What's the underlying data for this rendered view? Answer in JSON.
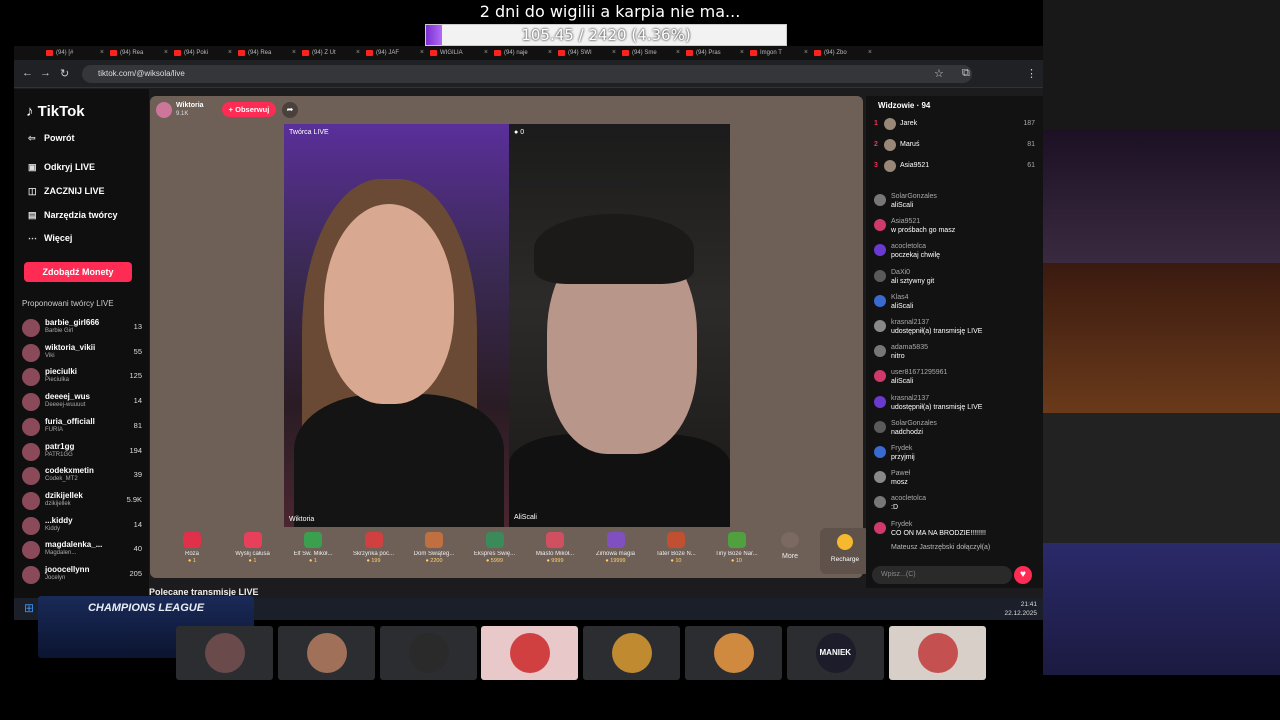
{
  "overlay": {
    "title": "2 dni do wigilii a karpia nie ma...",
    "goal_text": "105.45 / 2420 (4.36%)",
    "goal_progress": 0.0436,
    "accent": "#8a3ee0"
  },
  "browser": {
    "url": "tiktok.com/@wiksola/live",
    "tabs": [
      "(94) [#",
      "(94) Rea",
      "(94) Poki",
      "(94) Rea",
      "(94) Z Ut",
      "(94) JAF",
      "WIGILIA",
      "(94) naje",
      "(94) SWI",
      "(94) Sme",
      "(94) Pras",
      "Imgon T",
      "(94) Zbo"
    ]
  },
  "sidebar": {
    "logo": "TikTok",
    "items": [
      {
        "icon": "back-icon",
        "label": "Powrót"
      },
      {
        "icon": "live-icon",
        "label": "Odkryj LIVE"
      },
      {
        "icon": "camera-icon",
        "label": "ZACZNIJ LIVE"
      },
      {
        "icon": "tools-icon",
        "label": "Narzędzia twórcy"
      },
      {
        "icon": "more-icon",
        "label": "Więcej"
      }
    ],
    "coins_button": "Zdobądź Monety",
    "suggested_title": "Proponowani twórcy LIVE",
    "creators": [
      {
        "name": "barbie_girl666",
        "sub": "Barbie Girl",
        "count": "13"
      },
      {
        "name": "wiktoria_vikii",
        "sub": "Viki",
        "count": "55"
      },
      {
        "name": "pieciulki",
        "sub": "Pieciulka",
        "count": "125"
      },
      {
        "name": "deeeej_wus",
        "sub": "Deeeej-wuuuut",
        "count": "14"
      },
      {
        "name": "furia_officiall",
        "sub": "FURIA",
        "count": "81"
      },
      {
        "name": "patr1gg",
        "sub": "PATR1GG",
        "count": "194"
      },
      {
        "name": "codekxmetin",
        "sub": "Codek_MT2",
        "count": "39"
      },
      {
        "name": "dzikijellek",
        "sub": "dzikijellek",
        "count": "5.9K"
      },
      {
        "name": "...kiddy",
        "sub": "Kiddy",
        "count": "14"
      },
      {
        "name": "magdalenka_...",
        "sub": "Magdalen...",
        "count": "40"
      },
      {
        "name": "jooocellynn",
        "sub": "Jocelyn",
        "count": "205"
      }
    ]
  },
  "live": {
    "host_name": "Wiktoria",
    "host_likes": "9.1K",
    "follow_label": "+ Obserwuj",
    "left_label": "Twórca LIVE",
    "left_name": "Wiktoria",
    "right_name": "AliScali",
    "right_count": "0",
    "gifts": [
      {
        "name": "Róża",
        "price": "1",
        "color": "#e0304a"
      },
      {
        "name": "Wyślij całusa",
        "price": "1",
        "color": "#e8405a"
      },
      {
        "name": "Elf Św. Mikoł...",
        "price": "1",
        "color": "#3aa050"
      },
      {
        "name": "Skrzynka poc...",
        "price": "199",
        "color": "#d04040"
      },
      {
        "name": "Dom Świąteg...",
        "price": "2200",
        "color": "#c07040"
      },
      {
        "name": "Ekspres Świę...",
        "price": "5999",
        "color": "#3a8a5a"
      },
      {
        "name": "Miasto Mikoł...",
        "price": "9999",
        "color": "#d05060"
      },
      {
        "name": "Zimowa magia",
        "price": "19999",
        "color": "#8050c0"
      },
      {
        "name": "Tater Boże N...",
        "price": "10",
        "color": "#c05030"
      },
      {
        "name": "Tiny Boże Nar...",
        "price": "10",
        "color": "#50a040"
      }
    ],
    "more_label": "More",
    "recharge_label": "Recharge"
  },
  "chat": {
    "viewers_title": "Widzowie · 94",
    "top": [
      {
        "rank": "1",
        "name": "Jarek",
        "score": "187"
      },
      {
        "rank": "2",
        "name": "Maruś",
        "score": "81"
      },
      {
        "rank": "3",
        "name": "Asia9521",
        "score": "61"
      }
    ],
    "messages": [
      {
        "user": "SolarGonzales",
        "text": "aliScali"
      },
      {
        "user": "Asia9521",
        "text": "w prośbach go masz"
      },
      {
        "user": "acocletolca",
        "text": "poczekaj chwilę"
      },
      {
        "user": "DaXi0",
        "text": "ali sztywny git"
      },
      {
        "user": "Klas4",
        "text": "aliScali"
      },
      {
        "user": "krasnal2137",
        "text": "udostępnił(a) transmisję LIVE"
      },
      {
        "user": "adama5835",
        "text": "nitro"
      },
      {
        "user": "user81671295961",
        "text": "aliScali"
      },
      {
        "user": "krasnal2137",
        "text": "udostępnił(a) transmisję LIVE"
      },
      {
        "user": "SolarGonzales",
        "text": "nadchodzi"
      },
      {
        "user": "Frydek",
        "text": "przyjmij"
      },
      {
        "user": "Paweł",
        "text": "mosz"
      },
      {
        "user": "acocletolca",
        "text": ":D"
      },
      {
        "user": "Frydek",
        "text": "CO ON MA NA BRODZIE!!!!!!!!"
      }
    ],
    "joined": "Mateusz Jastrzębski dołączył(a)",
    "placeholder": "Wpisz...(C)"
  },
  "taskbar": {
    "below_live": "Polecane transmisje LIVE",
    "time": "21:41",
    "date": "22.12.2025"
  },
  "discord": {
    "champions": "CHAMPIONS LEAGUE",
    "tiles": [
      {
        "color": "#6a4a4a"
      },
      {
        "color": "#a07058"
      },
      {
        "color": "#2a2a2a"
      },
      {
        "color": "#d04040"
      },
      {
        "color": "#c08a30"
      },
      {
        "color": "#d08a40"
      },
      {
        "color": "#1c1c2a"
      },
      {
        "color": "#c45050"
      }
    ],
    "maniek_label": "MANIEK"
  }
}
